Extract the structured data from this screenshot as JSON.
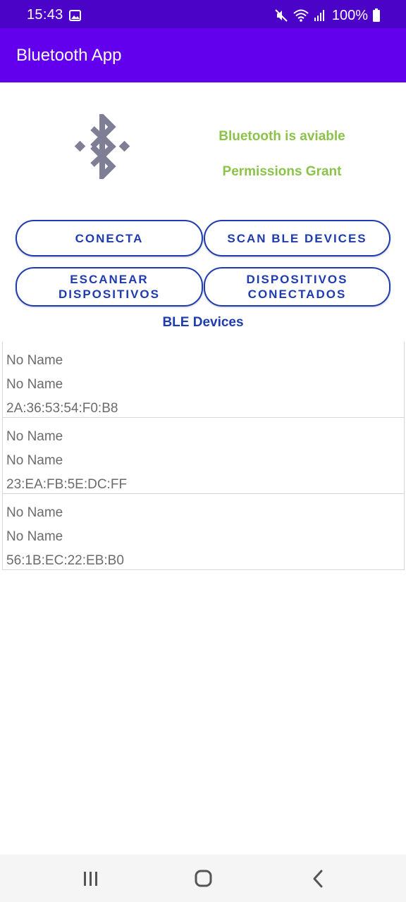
{
  "status_bar": {
    "time": "15:43",
    "battery": "100%",
    "icons": [
      "gallery-icon",
      "mute-icon",
      "wifi-icon",
      "signal-icon",
      "battery-icon"
    ],
    "background": "#4a03c7"
  },
  "app_bar": {
    "title": "Bluetooth App",
    "background": "#6200ee"
  },
  "header": {
    "logo_icon": "bluetooth-icon",
    "bluetooth_status": "Bluetooth is aviable",
    "permissions_status": "Permissions Grant",
    "status_color": "#8bc34a"
  },
  "buttons": {
    "conecta": "CONECTA",
    "scan_ble": "SCAN BLE DEVICES",
    "escanear": "ESCANEAR\nDISPOSITIVOS",
    "conectados": "DISPOSITIVOS\nCONECTADOS",
    "accent": "#1e3cb0"
  },
  "devices_section": {
    "title": "BLE Devices",
    "items": [
      {
        "name": "No Name",
        "alias": "No Name",
        "address": "2A:36:53:54:F0:B8"
      },
      {
        "name": "No Name",
        "alias": "No Name",
        "address": "23:EA:FB:5E:DC:FF"
      },
      {
        "name": "No Name",
        "alias": "No Name",
        "address": "56:1B:EC:22:EB:B0"
      }
    ]
  },
  "nav_bar": {
    "icons": [
      "recents-icon",
      "home-icon",
      "back-icon"
    ]
  }
}
